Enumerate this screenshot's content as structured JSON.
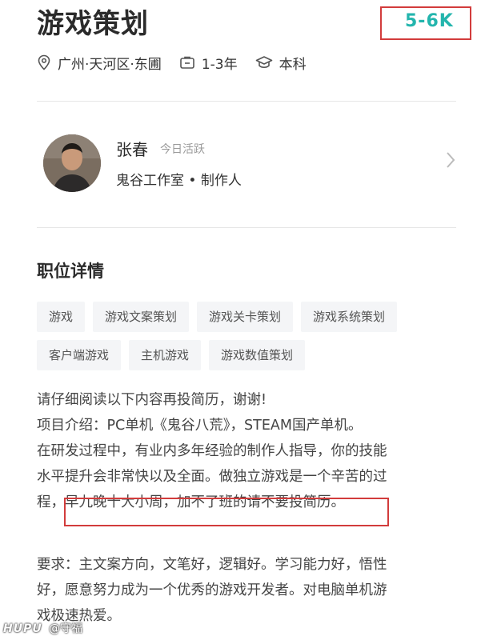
{
  "job": {
    "title": "游戏策划",
    "salary": "5-6K",
    "location": "广州·天河区·东圃",
    "experience": "1-3年",
    "education": "本科"
  },
  "recruiter": {
    "name": "张春",
    "status": "今日活跃",
    "company_role": "鬼谷工作室 • 制作人"
  },
  "details": {
    "section_title": "职位详情",
    "tags_row1": [
      "游戏",
      "游戏文案策划",
      "游戏关卡策划",
      "游戏系统策划"
    ],
    "tags_row2": [
      "客户端游戏",
      "主机游戏",
      "游戏数值策划"
    ],
    "desc_lines": [
      "请仔细阅读以下内容再投简历，谢谢!",
      "项目介绍：PC单机《鬼谷八荒》，STEAM国产单机。",
      "在研发过程中，有业内多年经验的制作人指导，你的技能",
      "水平提升会非常快以及全面。做独立游戏是一个辛苦的过",
      "程，早九晚十大小周，加不了班的请不要投简历。"
    ],
    "req_lines": [
      "要求：主文案方向，文笔好，逻辑好。学习能力好，悟性",
      "好，愿意努力成为一个优秀的游戏开发者。对电脑单机游",
      "戏极速热爱。"
    ]
  },
  "watermark": {
    "brand": "HUPU",
    "user": "@守福"
  },
  "colors": {
    "salary": "#23b5ad",
    "highlight_border": "#d23c3c"
  }
}
